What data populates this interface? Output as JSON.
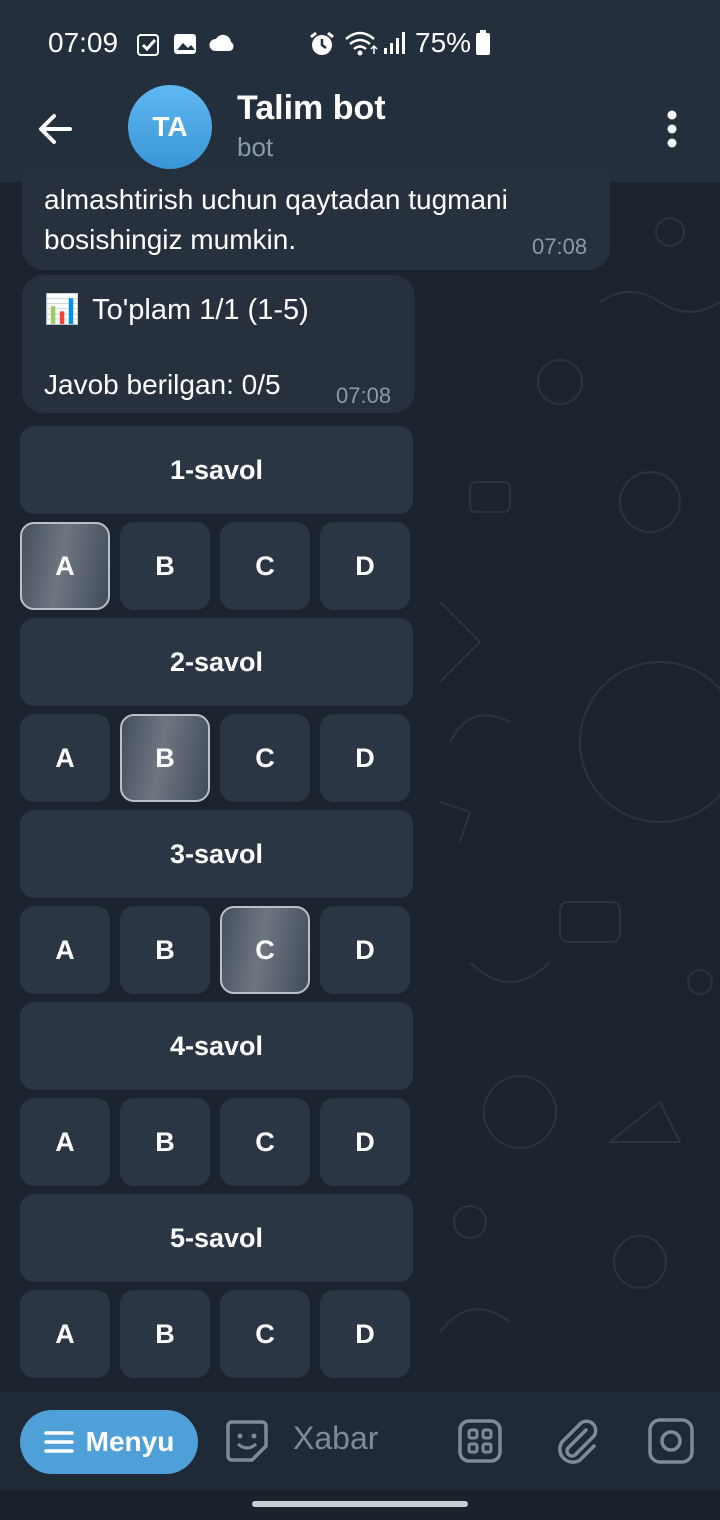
{
  "status_bar": {
    "time": "07:09",
    "battery": "75%"
  },
  "header": {
    "avatar_initials": "TA",
    "title": "Talim bot",
    "subtitle": "bot"
  },
  "messages": [
    {
      "text": "almashtirish uchun qaytadan tugmani bosishingiz mumkin.",
      "time": "07:08"
    },
    {
      "heading_icon": "📊",
      "heading": "To'plam 1/1 (1-5)",
      "status": "Javob berilgan: 0/5",
      "time": "07:08"
    }
  ],
  "keyboard": {
    "questions": [
      {
        "label": "1-savol",
        "options": [
          "A",
          "B",
          "C",
          "D"
        ],
        "selected": "A"
      },
      {
        "label": "2-savol",
        "options": [
          "A",
          "B",
          "C",
          "D"
        ],
        "selected": "B"
      },
      {
        "label": "3-savol",
        "options": [
          "A",
          "B",
          "C",
          "D"
        ],
        "selected": "C"
      },
      {
        "label": "4-savol",
        "options": [
          "A",
          "B",
          "C",
          "D"
        ],
        "selected": ""
      },
      {
        "label": "5-savol",
        "options": [
          "A",
          "B",
          "C",
          "D"
        ],
        "selected": ""
      }
    ]
  },
  "bottom_bar": {
    "menu_label": "Menyu",
    "input_placeholder": "Xabar"
  },
  "colors": {
    "accent": "#4f9fd8",
    "bubble": "#27313d",
    "background": "#1b242e",
    "header": "#242f3d"
  }
}
